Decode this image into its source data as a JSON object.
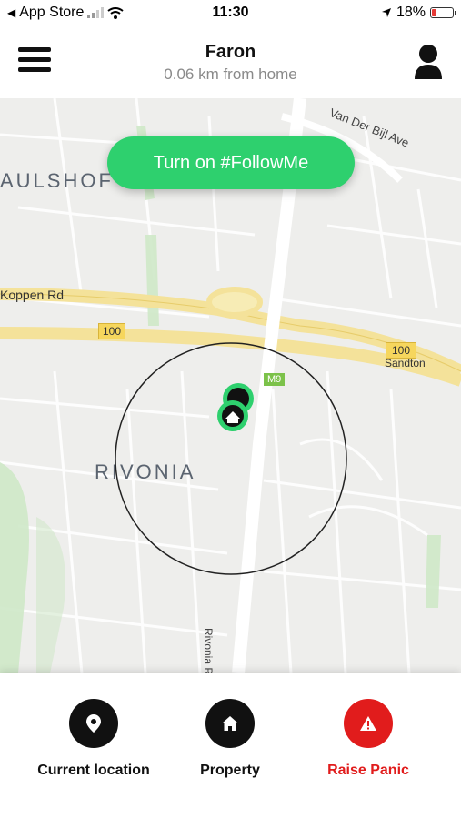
{
  "status_bar": {
    "back_app": "App Store",
    "time": "11:30",
    "battery": "18%"
  },
  "header": {
    "title": "Faron",
    "subtitle": "0.06 km from home"
  },
  "map": {
    "followme_button": "Turn on #FollowMe",
    "labels": {
      "aulshof": "AULSHOF",
      "rivonia": "RIVONIA",
      "van_der_bijl": "Van Der Bijl Ave",
      "koppen_rd": "Koppen Rd",
      "route_100_left": "100",
      "route_100_right": "100",
      "sandton": "Sandton",
      "m9": "M9",
      "rivonia_rd": "Rivonia R"
    }
  },
  "actions": {
    "current_location": "Current location",
    "property": "Property",
    "raise_panic": "Raise Panic"
  },
  "colors": {
    "accent_green": "#2ed06e",
    "panic_red": "#e11c1c"
  }
}
